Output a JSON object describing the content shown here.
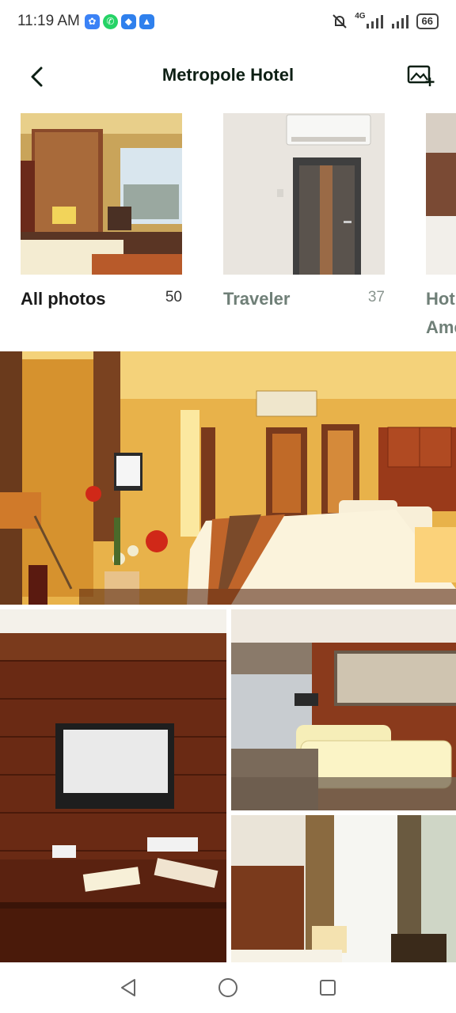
{
  "status_bar": {
    "time": "11:19 AM",
    "notification_icons": [
      "settings-app-icon",
      "whatsapp-icon",
      "messenger-icon",
      "alert-icon"
    ],
    "network": "4G",
    "battery": "66"
  },
  "header": {
    "title": "Metropole Hotel"
  },
  "categories": [
    {
      "label": "All photos",
      "count": "50",
      "selected": true
    },
    {
      "label": "Traveler",
      "count": "37",
      "selected": false
    },
    {
      "label": "Hot",
      "label_line2": "Ame",
      "selected": false
    }
  ],
  "photos": [
    {
      "name": "photo-bedroom-wide"
    },
    {
      "name": "photo-tv-wall"
    },
    {
      "name": "photo-lounge-sofa"
    },
    {
      "name": "photo-room-curtains"
    }
  ],
  "colors": {
    "title": "#0d1f14",
    "muted_label": "#6f7f77"
  }
}
